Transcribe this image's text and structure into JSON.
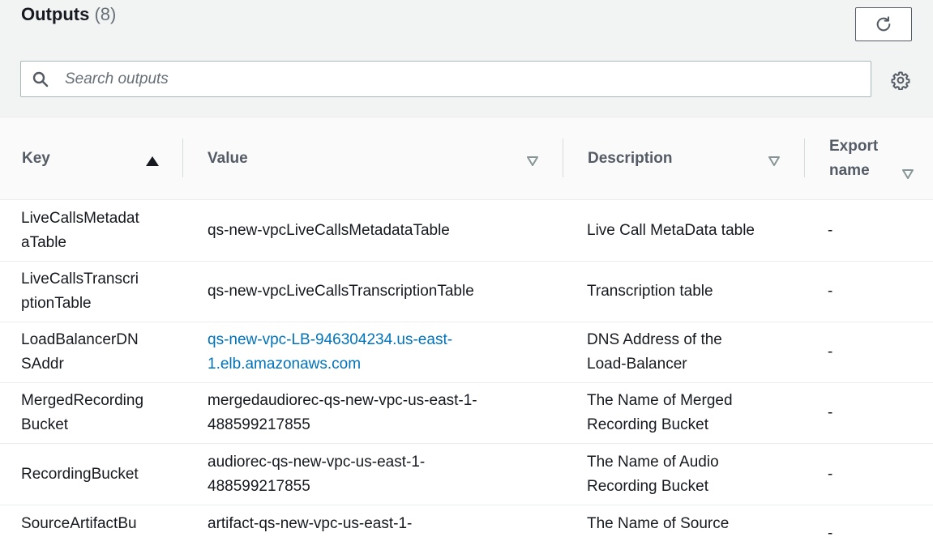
{
  "header": {
    "title": "Outputs",
    "count": "(8)",
    "search_placeholder": "Search outputs",
    "icons": {
      "refresh": "refresh-icon",
      "search": "search-icon",
      "settings": "gear-icon"
    }
  },
  "table": {
    "columns": [
      {
        "label": "Key",
        "sort": "ascending"
      },
      {
        "label": "Value",
        "sort": "none"
      },
      {
        "label": "Description",
        "sort": "none"
      },
      {
        "label_line1": "Export",
        "label_line2": "name",
        "sort": "none"
      }
    ],
    "rows": [
      {
        "key_line1": "LiveCallsMetadat",
        "key_line2": "aTable",
        "value_line1": "qs-new-vpcLiveCallsMetadataTable",
        "value_line2": "",
        "desc_line1": "Live Call MetaData table",
        "desc_line2": "",
        "export": "-"
      },
      {
        "key_line1": "LiveCallsTranscri",
        "key_line2": "ptionTable",
        "value_line1": "qs-new-vpcLiveCallsTranscriptionTable",
        "value_line2": "",
        "desc_line1": "Transcription table",
        "desc_line2": "",
        "export": "-"
      },
      {
        "key_line1": "LoadBalancerDN",
        "key_line2": "SAddr",
        "value_line1": "qs-new-vpc-LB-946304234.us-east-",
        "value_line2": "1.elb.amazonaws.com",
        "desc_line1": "DNS Address of the",
        "desc_line2": "Load-Balancer",
        "export": "-"
      },
      {
        "key_line1": "MergedRecording",
        "key_line2": "Bucket",
        "value_line1": "mergedaudiorec-qs-new-vpc-us-east-1-",
        "value_line2": "488599217855",
        "desc_line1": "The Name of Merged",
        "desc_line2": "Recording Bucket",
        "export": "-"
      },
      {
        "key_line1": "RecordingBucket",
        "key_line2": "",
        "value_line1": "audiorec-qs-new-vpc-us-east-1-",
        "value_line2": "488599217855",
        "desc_line1": "The Name of Audio",
        "desc_line2": "Recording Bucket",
        "export": "-"
      },
      {
        "key_line1": "SourceArtifactBu",
        "key_line2": "",
        "value_line1": "artifact-qs-new-vpc-us-east-1-",
        "value_line2": "",
        "desc_line1": "The Name of Source",
        "desc_line2": "",
        "export": "-"
      }
    ]
  },
  "colors": {
    "header_bg": "#f2f3f3",
    "text": "#16191f",
    "muted": "#687078",
    "link": "#0073bb",
    "column_header": "#545b64"
  }
}
